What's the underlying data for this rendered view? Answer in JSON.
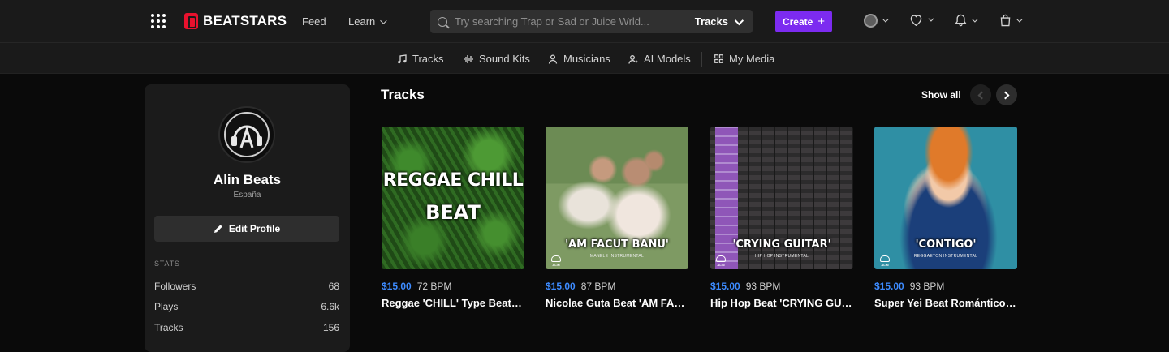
{
  "brand": {
    "name": "BEATSTARS",
    "accent": "#e8112d"
  },
  "nav": {
    "feed": "Feed",
    "learn": "Learn"
  },
  "search": {
    "placeholder": "Try searching Trap or Sad or Juice Wrld...",
    "category": "Tracks"
  },
  "create": {
    "label": "Create",
    "plus": "+",
    "color": "#7c2bf0"
  },
  "top_icons": [
    "user-avatar-icon",
    "heart-icon",
    "bell-icon",
    "cart-icon"
  ],
  "subnav": {
    "tracks": "Tracks",
    "sound_kits": "Sound Kits",
    "musicians": "Musicians",
    "ai_models": "AI Models",
    "my_media": "My Media"
  },
  "profile": {
    "name": "Alin Beats",
    "location": "España",
    "edit_label": "Edit Profile",
    "stats_heading": "STATS",
    "stats": [
      {
        "label": "Followers",
        "value": "68"
      },
      {
        "label": "Plays",
        "value": "6.6k"
      },
      {
        "label": "Tracks",
        "value": "156"
      }
    ]
  },
  "tracks_section": {
    "title": "Tracks",
    "show_all": "Show all",
    "items": [
      {
        "price": "$15.00",
        "bpm": "72 BPM",
        "title": "Reggae 'CHILL' Type Beat | Chill Reggae Instrumental",
        "cover_line1": "REGGAE CHILL",
        "cover_line2": "BEAT"
      },
      {
        "price": "$15.00",
        "bpm": "87 BPM",
        "title": "Nicolae Guta Beat 'AM FACUT BANU'",
        "cover_caption": "'AM FACUT BANU'",
        "cover_sub": "MANELE INSTRUMENTAL",
        "cover_badge": "ALIN"
      },
      {
        "price": "$15.00",
        "bpm": "93 BPM",
        "title": "Hip Hop Beat 'CRYING GUITAR'",
        "cover_caption": "'CRYING GUITAR'",
        "cover_sub": "HIP HOP INSTRUMENTAL",
        "cover_badge": "ALIN"
      },
      {
        "price": "$15.00",
        "bpm": "93 BPM",
        "title": "Super Yei Beat Romántico 'CONTIGO'",
        "cover_caption": "'CONTIGO'",
        "cover_sub": "REGGAETON INSTRUMENTAL",
        "cover_badge": "ALIN"
      }
    ]
  }
}
